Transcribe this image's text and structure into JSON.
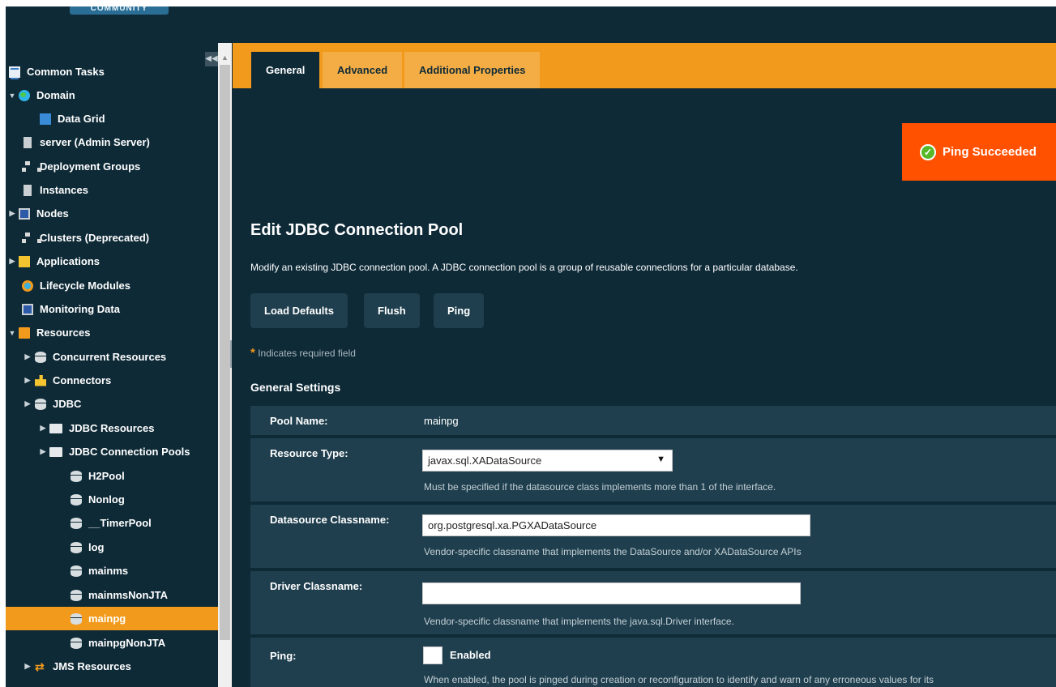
{
  "branding": {
    "badge_text": "COMMUNITY"
  },
  "sidebar": {
    "items": [
      {
        "label": "Common Tasks",
        "icon": "tasks-icon",
        "arrow": ""
      },
      {
        "label": "Domain",
        "icon": "globe-icon",
        "arrow": "▼"
      },
      {
        "label": "Data Grid",
        "icon": "grid-icon",
        "arrow": ""
      },
      {
        "label": "server (Admin Server)",
        "icon": "server-icon",
        "arrow": ""
      },
      {
        "label": "Deployment Groups",
        "icon": "group-icon",
        "arrow": ""
      },
      {
        "label": "Instances",
        "icon": "server-icon",
        "arrow": ""
      },
      {
        "label": "Nodes",
        "icon": "monitor-icon",
        "arrow": "▶"
      },
      {
        "label": "Clusters (Deprecated)",
        "icon": "group-icon",
        "arrow": ""
      },
      {
        "label": "Applications",
        "icon": "apps-icon",
        "arrow": "▶"
      },
      {
        "label": "Lifecycle Modules",
        "icon": "lifecycle-icon",
        "arrow": ""
      },
      {
        "label": "Monitoring Data",
        "icon": "monitor-icon",
        "arrow": ""
      },
      {
        "label": "Resources",
        "icon": "resources-icon",
        "arrow": "▼"
      },
      {
        "label": "Concurrent Resources",
        "icon": "database-icon",
        "arrow": "▶"
      },
      {
        "label": "Connectors",
        "icon": "connector-icon",
        "arrow": "▶"
      },
      {
        "label": "JDBC",
        "icon": "database-icon",
        "arrow": "▶"
      },
      {
        "label": "JDBC Resources",
        "icon": "folder-icon",
        "arrow": "▶"
      },
      {
        "label": "JDBC Connection Pools",
        "icon": "folder-icon",
        "arrow": "▶"
      },
      {
        "label": "H2Pool",
        "icon": "database-icon",
        "arrow": ""
      },
      {
        "label": "Nonlog",
        "icon": "database-icon",
        "arrow": ""
      },
      {
        "label": "__TimerPool",
        "icon": "database-icon",
        "arrow": ""
      },
      {
        "label": "log",
        "icon": "database-icon",
        "arrow": ""
      },
      {
        "label": "mainms",
        "icon": "database-icon",
        "arrow": ""
      },
      {
        "label": "mainmsNonJTA",
        "icon": "database-icon",
        "arrow": ""
      },
      {
        "label": "mainpg",
        "icon": "database-icon",
        "arrow": "",
        "selected": true
      },
      {
        "label": "mainpgNonJTA",
        "icon": "database-icon",
        "arrow": ""
      },
      {
        "label": "JMS Resources",
        "icon": "jms-icon",
        "arrow": "▶"
      }
    ],
    "collapse_glyph": "◀◀",
    "scroll_up_glyph": "▲"
  },
  "tabs": [
    {
      "label": "General",
      "active": true
    },
    {
      "label": "Advanced",
      "active": false
    },
    {
      "label": "Additional Properties",
      "active": false
    }
  ],
  "toast": {
    "message": "Ping Succeeded",
    "icon": "check-icon",
    "glyph": "✓"
  },
  "page": {
    "title": "Edit JDBC Connection Pool",
    "description": "Modify an existing JDBC connection pool. A JDBC connection pool is a group of reusable connections for a particular database.",
    "buttons": {
      "load_defaults": "Load Defaults",
      "flush": "Flush",
      "ping": "Ping"
    },
    "required_star": "*",
    "required_note": "Indicates required field",
    "section_title": "General Settings"
  },
  "form": {
    "pool_name": {
      "label": "Pool Name:",
      "value": "mainpg"
    },
    "resource_type": {
      "label": "Resource Type:",
      "value": "javax.sql.XADataSource",
      "help": "Must be specified if the datasource class implements more than 1 of the interface."
    },
    "datasource_classname": {
      "label": "Datasource Classname:",
      "value": "org.postgresql.xa.PGXADataSource",
      "help": "Vendor-specific classname that implements the DataSource and/or XADataSource APIs"
    },
    "driver_classname": {
      "label": "Driver Classname:",
      "value": "",
      "help": "Vendor-specific classname that implements the java.sql.Driver interface."
    },
    "ping": {
      "label": "Ping:",
      "checkbox_label": "Enabled",
      "checked": false,
      "help": "When enabled, the pool is pinged during creation or reconfiguration to identify and warn of any erroneous values for its"
    }
  },
  "colors": {
    "background": "#0e2a37",
    "accent": "#f19a1b",
    "toast": "#ff5100",
    "panel": "#1f3f4e"
  }
}
